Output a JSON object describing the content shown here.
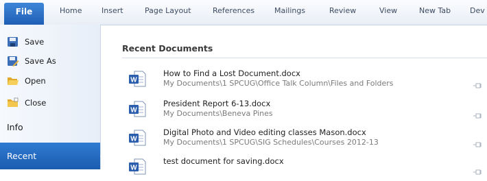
{
  "ribbon": {
    "file_tab": "File",
    "tabs": [
      "Home",
      "Insert",
      "Page Layout",
      "References",
      "Mailings",
      "Review",
      "View",
      "New Tab",
      "Dev"
    ]
  },
  "backstage": {
    "commands": [
      {
        "label": "Save",
        "icon": "save-icon"
      },
      {
        "label": "Save As",
        "icon": "save-as-icon"
      },
      {
        "label": "Open",
        "icon": "open-folder-icon"
      },
      {
        "label": "Close",
        "icon": "close-folder-icon"
      }
    ],
    "info": "Info",
    "recent": "Recent"
  },
  "recent_documents": {
    "title": "Recent Documents",
    "items": [
      {
        "name": "How to Find a Lost Document.docx",
        "path": "My Documents\\1 SPCUG\\Office Talk Column\\Files and Folders"
      },
      {
        "name": "President Report 6-13.docx",
        "path": "My Documents\\Beneva Pines"
      },
      {
        "name": "Digital Photo and Video editing classes Mason.docx",
        "path": "My Documents\\1 SPCUG\\SIG Schedules\\Courses 2012-13"
      },
      {
        "name": "test document for saving.docx",
        "path": ""
      }
    ]
  },
  "colors": {
    "accent": "#2b6fc7",
    "ribbon_text": "#3d4b62"
  }
}
